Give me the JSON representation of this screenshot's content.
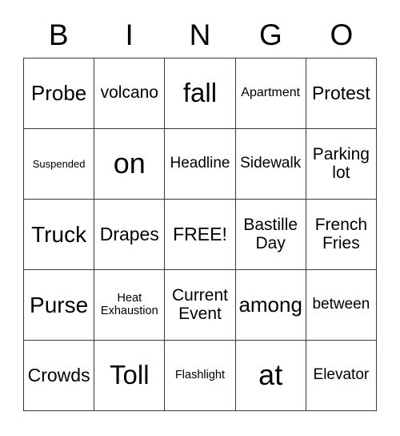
{
  "card": {
    "title_letters": [
      "B",
      "I",
      "N",
      "G",
      "O"
    ],
    "columns": 5,
    "rows": 5,
    "free_space_label": "FREE!",
    "free_space_position": "center",
    "colors": {
      "background": "#ffffff",
      "text": "#000000",
      "grid_line": "#3a3a3a"
    },
    "cells": [
      [
        {
          "label": "Probe",
          "size": "ml"
        },
        {
          "label": "volcano",
          "size": "mm"
        },
        {
          "label": "fall",
          "size": "xl"
        },
        {
          "label": "Apartment",
          "size": "xs"
        },
        {
          "label": "Protest",
          "size": "md"
        }
      ],
      [
        {
          "label": "Suspended",
          "size": "tiny"
        },
        {
          "label": "on",
          "size": "xxl"
        },
        {
          "label": "Headline",
          "size": "sm"
        },
        {
          "label": "Sidewalk",
          "size": "sm"
        },
        {
          "label": "Parking lot",
          "size": "mm"
        }
      ],
      [
        {
          "label": "Truck",
          "size": "lg"
        },
        {
          "label": "Drapes",
          "size": "md"
        },
        {
          "label": "FREE!",
          "size": "md"
        },
        {
          "label": "Bastille Day",
          "size": "mm"
        },
        {
          "label": "French Fries",
          "size": "mm"
        }
      ],
      [
        {
          "label": "Purse",
          "size": "lg"
        },
        {
          "label": "Heat Exhaustion",
          "size": "xxs"
        },
        {
          "label": "Current Event",
          "size": "mm"
        },
        {
          "label": "among",
          "size": "ml"
        },
        {
          "label": "between",
          "size": "sm"
        }
      ],
      [
        {
          "label": "Crowds",
          "size": "md"
        },
        {
          "label": "Toll",
          "size": "xl"
        },
        {
          "label": "Flashlight",
          "size": "xxs"
        },
        {
          "label": "at",
          "size": "xxl"
        },
        {
          "label": "Elevator",
          "size": "sm"
        }
      ]
    ]
  }
}
